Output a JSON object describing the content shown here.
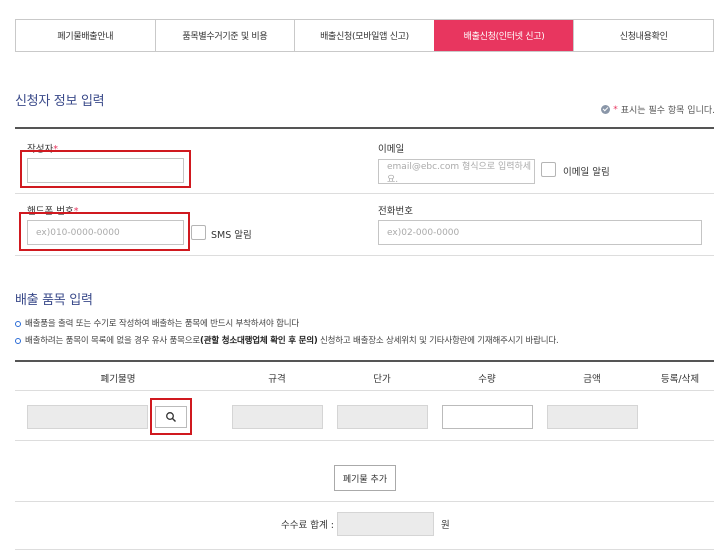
{
  "tabs": [
    {
      "label": "폐기물배출안내",
      "active": false
    },
    {
      "label": "품목별수거기준 및 비용",
      "active": false
    },
    {
      "label": "배출신청(모바일앱 신고)",
      "active": false
    },
    {
      "label": "배출신청(인터넷 신고)",
      "active": true
    },
    {
      "label": "신청내용확인",
      "active": false
    }
  ],
  "applicant": {
    "title": "신청자 정보 입력",
    "required_note": "표시는 필수 항목 입니다.",
    "required_mark": "*",
    "author_label": "작성자",
    "author_value": "",
    "email_label": "이메일",
    "email_placeholder": "email@ebc.com 형식으로 입력하세요.",
    "email_alert_label": "이메일 알림",
    "phone_label": "핸드폰 번호",
    "phone_placeholder": "ex)010-0000-0000",
    "sms_label": "SMS 알림",
    "tel_label": "전화번호",
    "tel_placeholder": "ex)02-000-0000"
  },
  "items": {
    "title": "배출 품목 입력",
    "note1": "배출품을 출력 또는 수기로 작성하여 배출하는 품목에 반드시 부착하셔야 합니다",
    "note2_pre": "배출하려는 품목이 목록에 없을 경우 유사 품목으로",
    "note2_bold": "(관할 청소대행업체 확인 후 문의)",
    "note2_post": " 신청하고 배출장소 상세위치 및 기타사항란에 기재해주시기 바랍니다.",
    "columns": [
      "폐기물명",
      "규격",
      "단가",
      "수량",
      "금액",
      "등록/삭제"
    ],
    "add_button": "폐기물 추가",
    "total_label": "수수료 합계 :",
    "currency": "원"
  },
  "colors": {
    "accent": "#e8365f",
    "title": "#3a4a8a",
    "highlight": "#d0191f"
  }
}
